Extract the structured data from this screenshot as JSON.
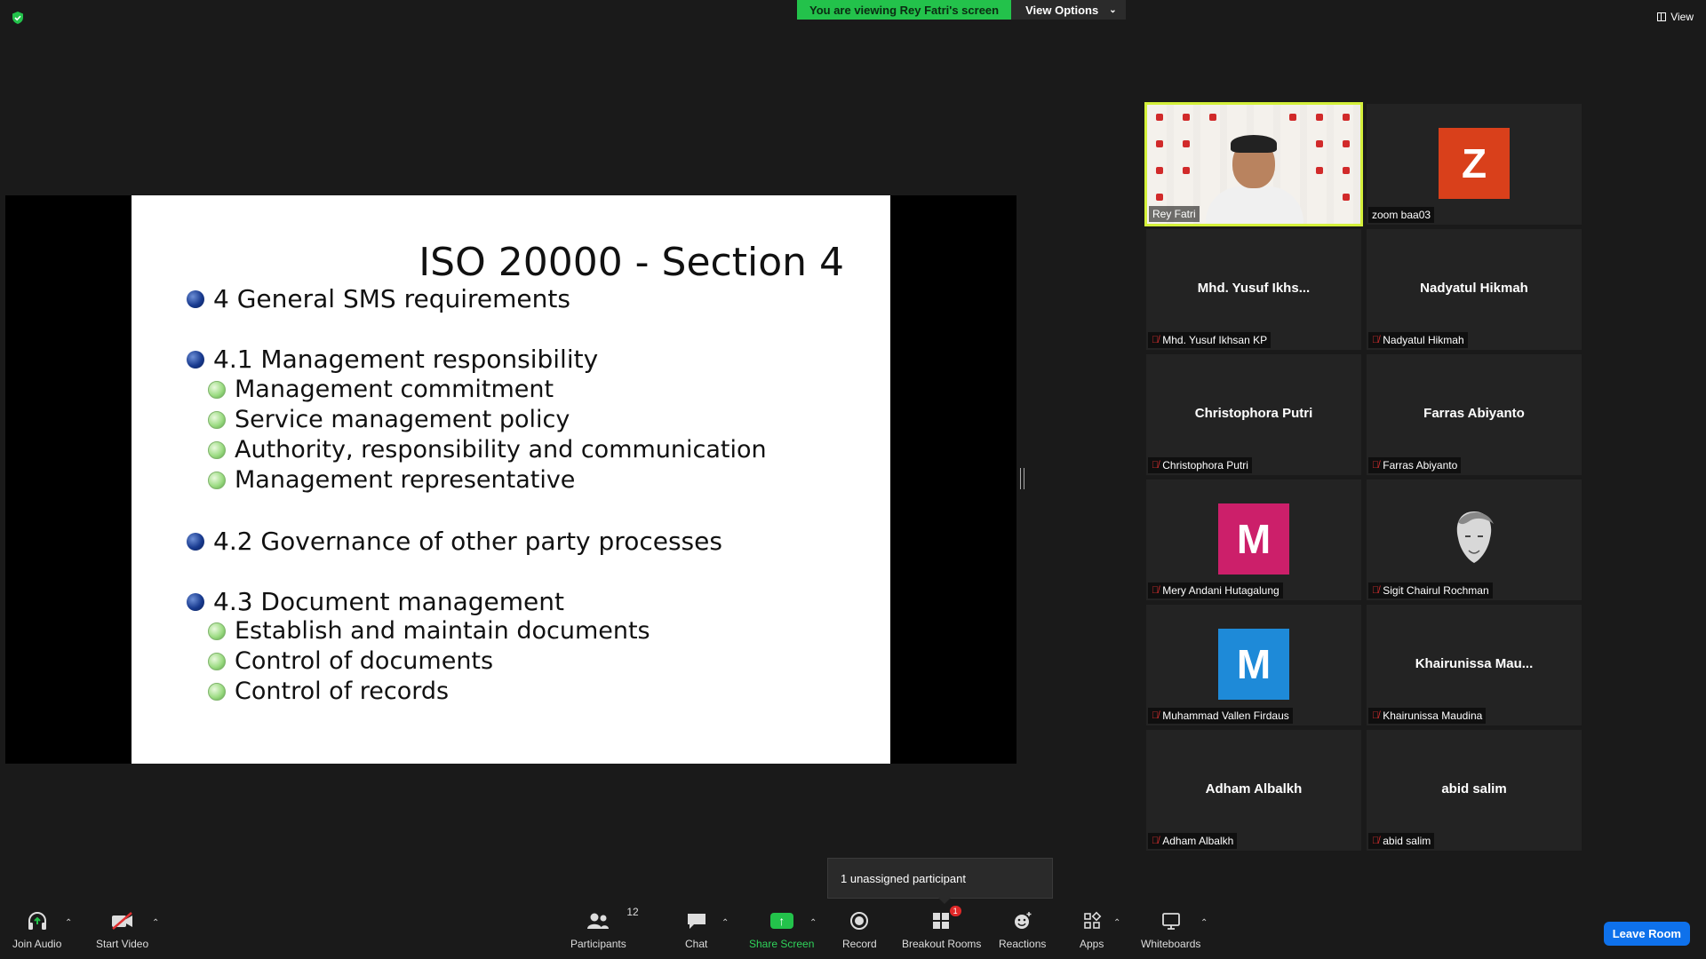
{
  "top_bar": {
    "viewing_text": "You are viewing Rey Fatri's screen",
    "view_options_label": "View Options",
    "view_label": "View"
  },
  "slide": {
    "title": "ISO 20000 - Section 4",
    "items": [
      {
        "level": 1,
        "text": "4 General SMS requirements"
      },
      {
        "level": 1,
        "text": "4.1 Management responsibility"
      },
      {
        "level": 2,
        "text": "Management commitment"
      },
      {
        "level": 2,
        "text": "Service management policy"
      },
      {
        "level": 2,
        "text": "Authority, responsibility and communication"
      },
      {
        "level": 2,
        "text": "Management representative"
      },
      {
        "level": 1,
        "text": "4.2 Governance of other party processes"
      },
      {
        "level": 1,
        "text": "4.3 Document management"
      },
      {
        "level": 2,
        "text": "Establish and maintain documents"
      },
      {
        "level": 2,
        "text": "Control of documents"
      },
      {
        "level": 2,
        "text": "Control of records"
      }
    ]
  },
  "participants": [
    {
      "label": "Rey Fatri",
      "type": "video",
      "active": true,
      "muted": false
    },
    {
      "label": "zoom baa03",
      "type": "avatar",
      "initial": "Z",
      "color": "#d9401b",
      "muted": false
    },
    {
      "label": "Mhd. Yusuf Ikhsan KP",
      "display": "Mhd. Yusuf Ikhs...",
      "type": "name",
      "muted": true
    },
    {
      "label": "Nadyatul Hikmah",
      "display": "Nadyatul Hikmah",
      "type": "name",
      "muted": true
    },
    {
      "label": "Christophora Putri",
      "display": "Christophora Putri",
      "type": "name",
      "muted": true
    },
    {
      "label": "Farras Abiyanto",
      "display": "Farras Abiyanto",
      "type": "name",
      "muted": true
    },
    {
      "label": "Mery Andani Hutagalung",
      "type": "avatar",
      "initial": "M",
      "color": "#cc1f6a",
      "muted": true
    },
    {
      "label": "Sigit Chairul Rochman",
      "type": "picture",
      "muted": true
    },
    {
      "label": "Muhammad Vallen Firdaus",
      "type": "avatar",
      "initial": "M",
      "color": "#1e8ad8",
      "muted": true
    },
    {
      "label": "Khairunissa Maudina",
      "display": "Khairunissa  Mau...",
      "type": "name",
      "muted": true
    },
    {
      "label": "Adham Albalkh",
      "display": "Adham Albalkh",
      "type": "name",
      "muted": true
    },
    {
      "label": "abid salim",
      "display": "abid salim",
      "type": "name",
      "muted": true
    }
  ],
  "popover": {
    "text": "1 unassigned participant"
  },
  "toolbar": {
    "join_audio": "Join Audio",
    "start_video": "Start Video",
    "participants": "Participants",
    "participants_count": "12",
    "chat": "Chat",
    "share_screen": "Share Screen",
    "record": "Record",
    "breakout_rooms": "Breakout Rooms",
    "breakout_badge": "1",
    "reactions": "Reactions",
    "apps": "Apps",
    "whiteboards": "Whiteboards",
    "leave_room": "Leave Room"
  },
  "colors": {
    "accent_green": "#23c24b",
    "active_speaker": "#d4f03a",
    "leave_blue": "#0e71eb",
    "muted_red": "#e03030"
  }
}
